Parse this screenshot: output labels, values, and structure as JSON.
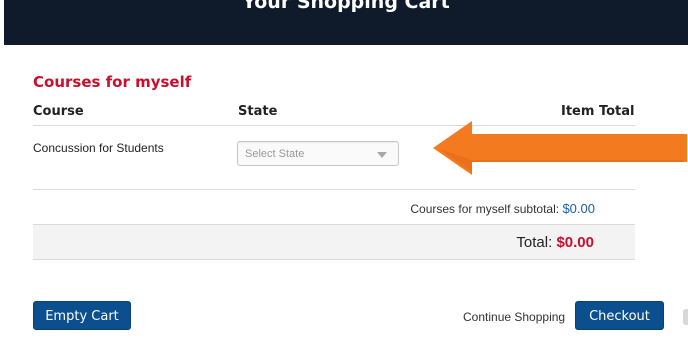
{
  "header": {
    "title": "Your Shopping Cart"
  },
  "cart": {
    "section_title": "Courses for myself",
    "columns": {
      "course": "Course",
      "state": "State",
      "item_total": "Item Total"
    },
    "items": [
      {
        "course": "Concussion for Students",
        "state_placeholder": "Select State"
      }
    ],
    "subtotal_label": "Courses for myself subtotal:",
    "subtotal_value": "$0.00",
    "total_label": "Total:",
    "total_value": "$0.00"
  },
  "actions": {
    "empty_cart": "Empty Cart",
    "continue_shopping": "Continue Shopping",
    "checkout": "Checkout"
  },
  "colors": {
    "header_bg": "#0f1a2b",
    "accent_red": "#c8102e",
    "button_blue": "#0b4f8f",
    "link_blue": "#1a5fa8",
    "arrow_orange": "#f47a20"
  },
  "annotation": {
    "type": "arrow",
    "direction": "left",
    "icon": "arrow-left-icon"
  }
}
